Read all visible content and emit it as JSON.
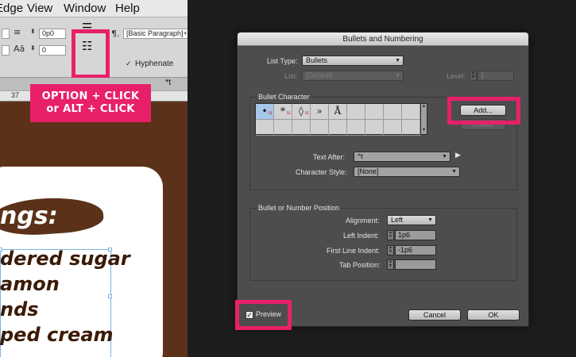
{
  "left_panel": {
    "menu": [
      "Edge",
      "View",
      "Window",
      "Help"
    ],
    "control_values": {
      "space_before": "0p0",
      "space_after": "0",
      "paragraph_style": "[Basic Paragraph]+",
      "hyphenate_label": "Hyphenate",
      "hyphenate_checked": "✓"
    },
    "doc_tab": "*t",
    "ruler_mark": "37",
    "callout_line1": "OPTION + CLICK",
    "callout_line2": "or ALT + CLICK",
    "heading": "ngs:",
    "recipe_lines": [
      "dered sugar",
      "amon",
      "nds",
      "ped cream"
    ],
    "colors": {
      "accent": "#e8206a",
      "brown": "#5b3219",
      "text_dark": "#3b1a06"
    },
    "icons": [
      "bulleted-list-icon",
      "numbered-list-icon",
      "paragraph-icon"
    ]
  },
  "dialog": {
    "title": "Bullets and Numbering",
    "list_type_label": "List Type:",
    "list_type_value": "Bullets",
    "list_label": "List:",
    "list_value": "[Default]",
    "level_label": "Level:",
    "level_value": "1",
    "bullet_character_title": "Bullet Character",
    "bullet_glyphs": [
      {
        "glyph": "•",
        "mark": "u"
      },
      {
        "glyph": "*",
        "mark": "u"
      },
      {
        "glyph": "◊",
        "mark": "u"
      },
      {
        "glyph": "»",
        "mark": ""
      },
      {
        "glyph": "Å",
        "mark": ""
      }
    ],
    "add_button": "Add...",
    "delete_button": "Delete",
    "text_after_label": "Text After:",
    "text_after_value": "^t",
    "character_style_label": "Character Style:",
    "character_style_value": "[None]",
    "position_title": "Bullet or Number Position",
    "alignment_label": "Alignment:",
    "alignment_value": "Left",
    "left_indent_label": "Left Indent:",
    "left_indent_value": "1p6",
    "first_line_indent_label": "First Line Indent:",
    "first_line_indent_value": "-1p6",
    "tab_position_label": "Tab Position:",
    "tab_position_value": "",
    "preview_label": "Preview",
    "preview_checked": "✓",
    "cancel_button": "Cancel",
    "ok_button": "OK"
  }
}
